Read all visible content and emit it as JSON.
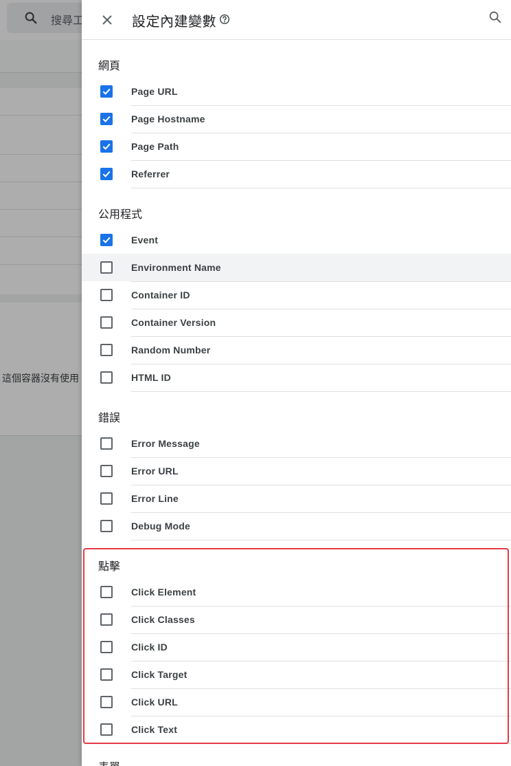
{
  "background": {
    "search_placeholder": "搜尋工",
    "empty_text": "這個容器沒有使用"
  },
  "dialog": {
    "title": "設定內建變數"
  },
  "sections": [
    {
      "heading": "網頁",
      "items": [
        {
          "label": "Page URL",
          "checked": true
        },
        {
          "label": "Page Hostname",
          "checked": true
        },
        {
          "label": "Page Path",
          "checked": true
        },
        {
          "label": "Referrer",
          "checked": true
        }
      ]
    },
    {
      "heading": "公用程式",
      "items": [
        {
          "label": "Event",
          "checked": true
        },
        {
          "label": "Environment Name",
          "checked": false
        },
        {
          "label": "Container ID",
          "checked": false
        },
        {
          "label": "Container Version",
          "checked": false
        },
        {
          "label": "Random Number",
          "checked": false
        },
        {
          "label": "HTML ID",
          "checked": false
        }
      ]
    },
    {
      "heading": "錯誤",
      "items": [
        {
          "label": "Error Message",
          "checked": false
        },
        {
          "label": "Error URL",
          "checked": false
        },
        {
          "label": "Error Line",
          "checked": false
        },
        {
          "label": "Debug Mode",
          "checked": false
        }
      ]
    },
    {
      "heading": "點擊",
      "items": [
        {
          "label": "Click Element",
          "checked": false
        },
        {
          "label": "Click Classes",
          "checked": false
        },
        {
          "label": "Click ID",
          "checked": false
        },
        {
          "label": "Click Target",
          "checked": false
        },
        {
          "label": "Click URL",
          "checked": false
        },
        {
          "label": "Click Text",
          "checked": false
        }
      ]
    },
    {
      "heading": "表單",
      "items": []
    }
  ],
  "icons": {
    "close": "close-icon",
    "help": "help-circle-icon",
    "search": "search-icon",
    "check": "check-icon"
  },
  "colors": {
    "checkbox_checked": "#1a73e8",
    "highlight_border": "#e53945"
  }
}
